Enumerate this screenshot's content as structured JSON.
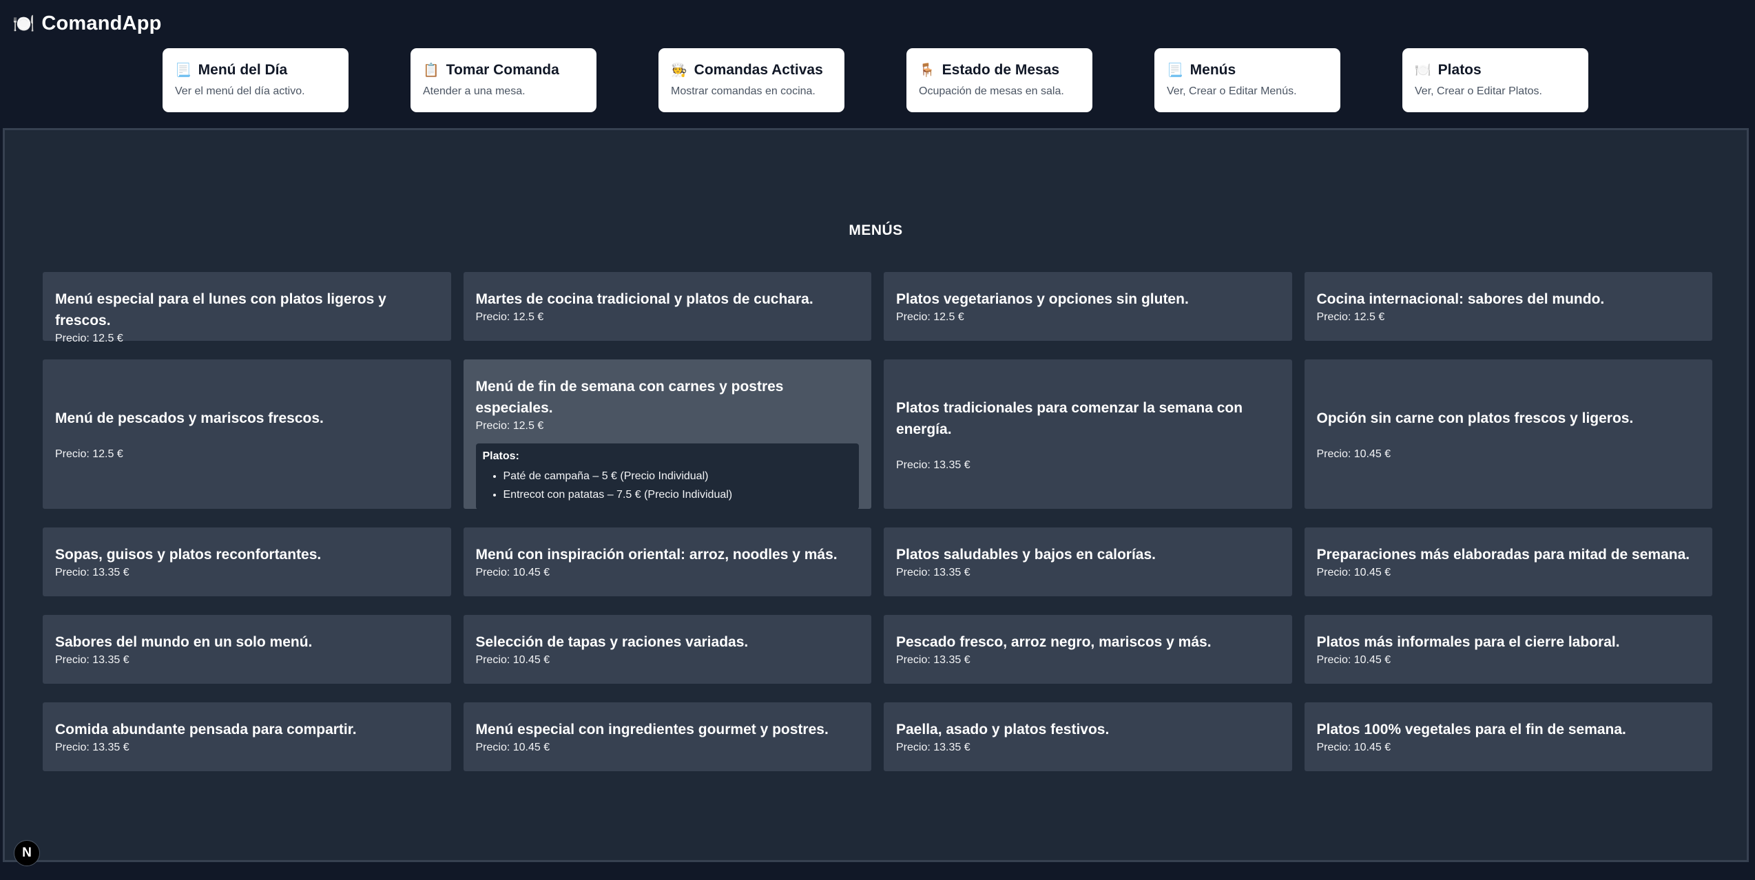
{
  "app": {
    "title": "ComandApp",
    "logo_icon": "🍽️",
    "logo_icon_name": "plate-icon"
  },
  "nav": [
    {
      "title": "Menú del Día",
      "icon": "📃",
      "description": "Ver el menú del día activo."
    },
    {
      "title": "Tomar Comanda",
      "icon": "📋",
      "description": "Atender a una mesa."
    },
    {
      "title": "Comandas Activas",
      "icon": "🧑‍🍳",
      "description": "Mostrar comandas en cocina."
    },
    {
      "title": "Estado de Mesas",
      "icon": "🪑",
      "description": "Ocupación de mesas en sala."
    },
    {
      "title": "Menús",
      "icon": "📃",
      "description": "Ver, Crear o Editar Menús."
    },
    {
      "title": "Platos",
      "icon": "🍽️",
      "description": "Ver, Crear o Editar Platos."
    }
  ],
  "section": {
    "title": "MENÚS"
  },
  "menus": [
    {
      "title": "Menú especial para el lunes con platos ligeros y frescos.",
      "price": "Precio: 12.5 €"
    },
    {
      "title": "Martes de cocina tradicional y platos de cuchara.",
      "price": "Precio: 12.5 €"
    },
    {
      "title": "Platos vegetarianos y opciones sin gluten.",
      "price": "Precio: 12.5 €"
    },
    {
      "title": "Cocina internacional: sabores del mundo.",
      "price": "Precio: 12.5 €"
    },
    {
      "title": "Menú de pescados y mariscos frescos.",
      "price": "Precio: 12.5 €"
    },
    {
      "title": "Menú de fin de semana con carnes y postres especiales.",
      "price": "Precio: 12.5 €",
      "dishes_label": "Platos:",
      "dishes": [
        "Paté de campaña – 5 € (Precio Individual)",
        "Entrecot con patatas – 7.5 € (Precio Individual)"
      ]
    },
    {
      "title": "Platos tradicionales para comenzar la semana con energía.",
      "price": "Precio: 13.35 €"
    },
    {
      "title": "Opción sin carne con platos frescos y ligeros.",
      "price": "Precio: 10.45 €"
    },
    {
      "title": "Sopas, guisos y platos reconfortantes.",
      "price": "Precio: 13.35 €"
    },
    {
      "title": "Menú con inspiración oriental: arroz, noodles y más.",
      "price": "Precio: 10.45 €"
    },
    {
      "title": "Platos saludables y bajos en calorías.",
      "price": "Precio: 13.35 €"
    },
    {
      "title": "Preparaciones más elaboradas para mitad de semana.",
      "price": "Precio: 10.45 €"
    },
    {
      "title": "Sabores del mundo en un solo menú.",
      "price": "Precio: 13.35 €"
    },
    {
      "title": "Selección de tapas y raciones variadas.",
      "price": "Precio: 10.45 €"
    },
    {
      "title": "Pescado fresco, arroz negro, mariscos y más.",
      "price": "Precio: 13.35 €"
    },
    {
      "title": "Platos más informales para el cierre laboral.",
      "price": "Precio: 10.45 €"
    },
    {
      "title": "Comida abundante pensada para compartir.",
      "price": "Precio: 13.35 €"
    },
    {
      "title": "Menú especial con ingredientes gourmet y postres.",
      "price": "Precio: 10.45 €"
    },
    {
      "title": "Paella, asado y platos festivos.",
      "price": "Precio: 13.35 €"
    },
    {
      "title": "Platos 100% vegetales para el fin de semana.",
      "price": "Precio: 10.45 €"
    }
  ],
  "dev_badge": {
    "label": "N",
    "icon_name": "nextjs-icon"
  },
  "colors": {
    "header_bg": "#111827",
    "main_bg": "#1f2937",
    "card_bg": "#374151",
    "card_hover_bg": "#4b5563",
    "nav_card_bg": "#ffffff"
  }
}
